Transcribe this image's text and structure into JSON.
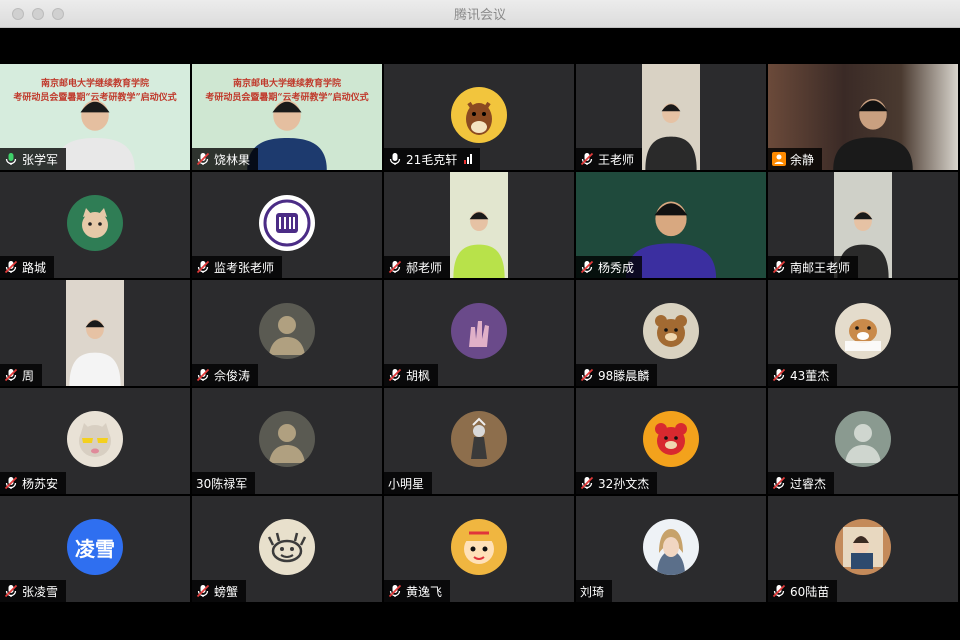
{
  "window": {
    "title": "腾讯会议"
  },
  "banner": {
    "line1": "南京邮电大学继续教育学院",
    "line2": "考研动员会暨暑期“云考研教学”启动仪式"
  },
  "colors": {
    "active_speaker": "#3fd16a",
    "tile_bg": "#2b2b2d",
    "muted_mic": "#e23b3b",
    "text_avatar": "#2f6ff0"
  },
  "participants": [
    {
      "name": "张学军",
      "mic": "active",
      "view": "video",
      "icon": "person-video"
    },
    {
      "name": "饶林果",
      "mic": "muted",
      "view": "video",
      "icon": "person-video"
    },
    {
      "name": "21毛克轩",
      "mic": "on",
      "view": "avatar",
      "icon": "horse-avatar"
    },
    {
      "name": "王老师",
      "mic": "muted",
      "view": "video",
      "icon": "person-video"
    },
    {
      "name": "余静",
      "mic": "host",
      "view": "video",
      "icon": "person-video"
    },
    {
      "name": "路城",
      "mic": "muted",
      "view": "avatar",
      "icon": "cat-avatar"
    },
    {
      "name": "监考张老师",
      "mic": "muted",
      "view": "avatar",
      "icon": "university-logo-avatar"
    },
    {
      "name": "郝老师",
      "mic": "muted",
      "view": "video",
      "icon": "person-video"
    },
    {
      "name": "杨秀成",
      "mic": "muted",
      "view": "video",
      "icon": "person-video"
    },
    {
      "name": "南邮王老师",
      "mic": "muted",
      "view": "video",
      "icon": "person-video"
    },
    {
      "name": "周",
      "mic": "muted",
      "view": "video",
      "icon": "person-video"
    },
    {
      "name": "佘俊涛",
      "mic": "muted",
      "view": "avatar",
      "icon": "photo-avatar"
    },
    {
      "name": "胡枫",
      "mic": "muted",
      "view": "avatar",
      "icon": "hand-avatar"
    },
    {
      "name": "98滕晨麟",
      "mic": "muted",
      "view": "avatar",
      "icon": "teddy-bear-avatar"
    },
    {
      "name": "43董杰",
      "mic": "muted",
      "view": "avatar",
      "icon": "dog-avatar"
    },
    {
      "name": "杨苏安",
      "mic": "muted",
      "view": "avatar",
      "icon": "cat-sunglasses-avatar"
    },
    {
      "name": "30陈禄军",
      "mic": "none",
      "view": "avatar",
      "icon": "photo-avatar"
    },
    {
      "name": "小明星",
      "mic": "none",
      "view": "avatar",
      "icon": "figure-avatar"
    },
    {
      "name": "32孙文杰",
      "mic": "muted",
      "view": "avatar",
      "icon": "bear-toy-avatar"
    },
    {
      "name": "过睿杰",
      "mic": "muted",
      "view": "avatar",
      "icon": "cat-photo-avatar"
    },
    {
      "name": "张凌雪",
      "mic": "muted",
      "view": "text-avatar",
      "avatar_text": "凌雪",
      "icon": "text-avatar"
    },
    {
      "name": "螃蟹",
      "mic": "muted",
      "view": "avatar",
      "icon": "crab-avatar"
    },
    {
      "name": "黄逸飞",
      "mic": "muted",
      "view": "avatar",
      "icon": "tiger-cartoon-avatar"
    },
    {
      "name": "刘琦",
      "mic": "none",
      "view": "avatar",
      "icon": "portrait-avatar"
    },
    {
      "name": "60陆苗",
      "mic": "muted",
      "view": "avatar",
      "icon": "illustration-avatar"
    }
  ]
}
